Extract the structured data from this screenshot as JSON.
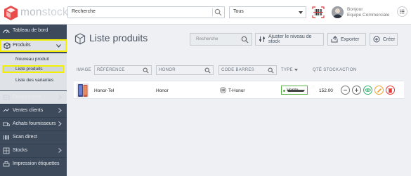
{
  "app": {
    "name": "monstock",
    "name_part1": "mon",
    "name_part2": "stock",
    "brand_color": "#e94b4b"
  },
  "topbar": {
    "search_placeholder": "Recherche",
    "select_value": "Tous",
    "user_greeting": "Bonjour",
    "user_team": "Equipe Commerciale"
  },
  "sidebar": {
    "items": [
      {
        "label": "Tableau de bord",
        "icon": "dashboard-icon"
      },
      {
        "label": "Produits",
        "icon": "box-icon"
      },
      {
        "label": "Equipements",
        "icon": "equipment-icon"
      },
      {
        "label": "Ventes clients",
        "icon": "sales-icon"
      },
      {
        "label": "Achats fournisseurs",
        "icon": "truck-icon"
      },
      {
        "label": "Scan direct",
        "icon": "scan-icon"
      },
      {
        "label": "Stocks",
        "icon": "stock-icon"
      },
      {
        "label": "Impression étiquettes",
        "icon": "print-icon"
      }
    ],
    "sub_items": [
      {
        "label": "Nouveau produit"
      },
      {
        "label": "Liste produits"
      },
      {
        "label": "Liste des variantes"
      }
    ]
  },
  "page": {
    "title": "Liste produits",
    "search_placeholder": "Recherche",
    "adjust_label": "Ajuster le niveau de stock",
    "export_label": "Exporter",
    "create_label": "Créer"
  },
  "table": {
    "headers": {
      "image": "IMAGE",
      "reference": "RÉFÉRENCE",
      "brand": "HONOR",
      "barcode": "CODE BARRES",
      "type": "TYPE",
      "qty": "QTÉ STOCK",
      "action": "ACTION"
    },
    "rows": [
      {
        "reference": "Honor-Tel",
        "brand": "Honor",
        "barcode": "T-Honor",
        "type": "Vente",
        "qty": "152.00"
      }
    ]
  },
  "colors": {
    "sidebar_bg": "#3d4a5c",
    "highlight": "#f3ef00",
    "type_green": "#58b347",
    "delete_red": "#e23b3b",
    "edit_orange": "#f0a030",
    "view_green": "#3cb371"
  }
}
